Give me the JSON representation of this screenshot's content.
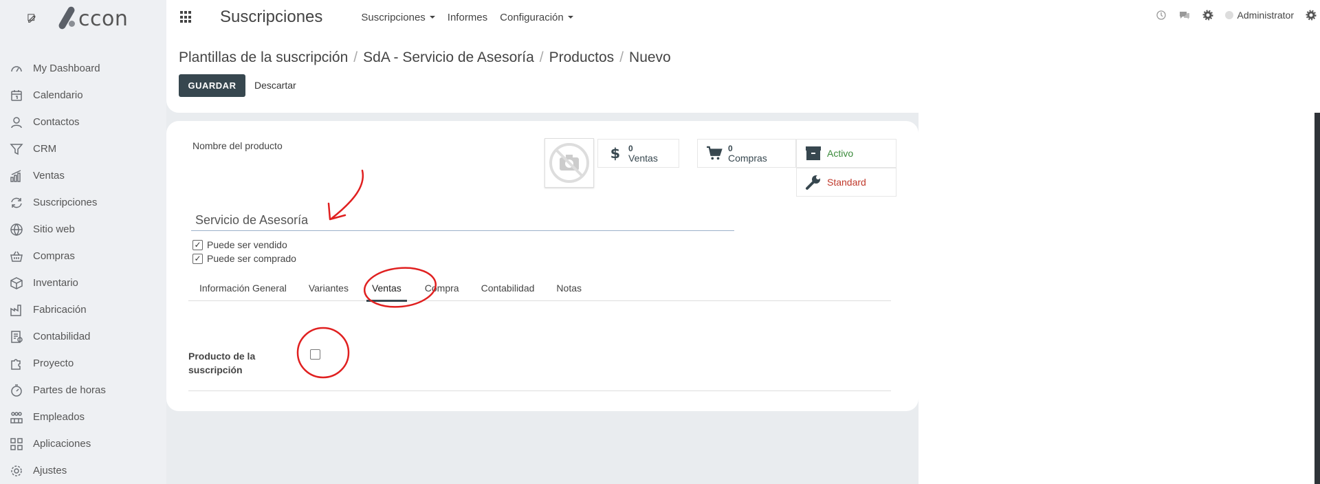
{
  "app": {
    "logo_text": "ccon",
    "title": "Suscripciones"
  },
  "top_menu": [
    {
      "label": "Suscripciones",
      "dropdown": true
    },
    {
      "label": "Informes",
      "dropdown": false
    },
    {
      "label": "Configuración",
      "dropdown": true
    }
  ],
  "user": {
    "name": "Administrator"
  },
  "sidebar": {
    "items": [
      {
        "label": "My Dashboard",
        "icon": "dashboard-icon"
      },
      {
        "label": "Calendario",
        "icon": "calendar-icon"
      },
      {
        "label": "Contactos",
        "icon": "contacts-icon"
      },
      {
        "label": "CRM",
        "icon": "filter-icon"
      },
      {
        "label": "Ventas",
        "icon": "sales-chart-icon"
      },
      {
        "label": "Suscripciones",
        "icon": "refresh-icon"
      },
      {
        "label": "Sitio web",
        "icon": "globe-icon"
      },
      {
        "label": "Compras",
        "icon": "basket-icon"
      },
      {
        "label": "Inventario",
        "icon": "box-icon"
      },
      {
        "label": "Fabricación",
        "icon": "factory-icon"
      },
      {
        "label": "Contabilidad",
        "icon": "invoice-icon"
      },
      {
        "label": "Proyecto",
        "icon": "puzzle-icon"
      },
      {
        "label": "Partes de horas",
        "icon": "stopwatch-icon"
      },
      {
        "label": "Empleados",
        "icon": "employees-icon"
      },
      {
        "label": "Aplicaciones",
        "icon": "apps-grid-icon"
      },
      {
        "label": "Ajustes",
        "icon": "settings-gear-icon"
      }
    ]
  },
  "breadcrumb": [
    "Plantillas de la suscripción",
    "SdA - Servicio de Asesoría",
    "Productos",
    "Nuevo"
  ],
  "buttons": {
    "save": "GUARDAR",
    "discard": "Descartar"
  },
  "form": {
    "name_label": "Nombre del producto",
    "name_value": "Servicio de Asesoría",
    "can_be_sold": {
      "label": "Puede ser vendido",
      "checked": true
    },
    "can_be_purchased": {
      "label": "Puede ser comprado",
      "checked": true
    },
    "stat_buttons": {
      "sales": {
        "count": "0",
        "label": "Ventas"
      },
      "purchases": {
        "count": "0",
        "label": "Compras"
      },
      "active": {
        "label": "Activo",
        "color": "#3a8a3a"
      },
      "standard": {
        "label": "Standard",
        "color": "#c0392b"
      }
    },
    "tabs": [
      "Información General",
      "Variantes",
      "Ventas",
      "Compra",
      "Contabilidad",
      "Notas"
    ],
    "active_tab": "Ventas",
    "subscription_product": {
      "label": "Producto de la suscripción",
      "checked": false
    }
  },
  "annotation_color": "#e02020"
}
